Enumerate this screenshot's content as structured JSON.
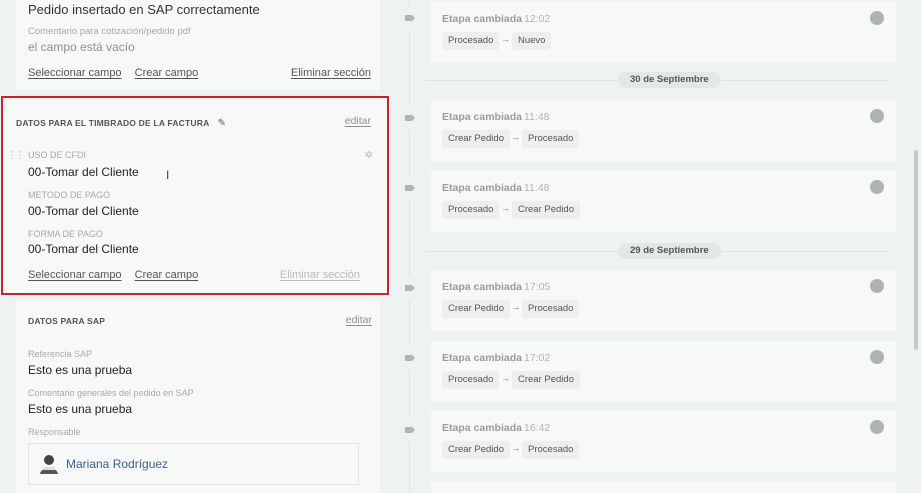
{
  "top_card": {
    "message": "Pedido insertado en SAP correctamente",
    "comment_label": "Comentario para cotización/pedido pdf",
    "comment_value": "el campo está vacío",
    "select_field": "Seleccionar campo",
    "create_field": "Crear campo",
    "delete_section": "Eliminar sección"
  },
  "invoice_section": {
    "title": "DATOS PARA EL TIMBRADO DE LA FACTURA",
    "edit": "editar",
    "fields": [
      {
        "label": "USO DE CFDI",
        "value": "00-Tomar del Cliente"
      },
      {
        "label": "METODO DE PAGO",
        "value": "00-Tomar del Cliente"
      },
      {
        "label": "FORMA DE PAGO",
        "value": "00-Tomar del Cliente"
      }
    ],
    "select_field": "Seleccionar campo",
    "create_field": "Crear campo",
    "delete_section": "Eliminar sección"
  },
  "sap_section": {
    "title": "DATOS PARA SAP",
    "edit": "editar",
    "ref_label": "Referencia SAP",
    "ref_value": "Esto es una prueba",
    "comment_label": "Comentario generales del pedido en SAP",
    "comment_value": "Esto es una prueba",
    "resp_label": "Responsable",
    "resp_name": "Mariana Rodríguez"
  },
  "timeline": {
    "dates": [
      "30 de Septiembre",
      "29 de Septiembre"
    ],
    "events": [
      {
        "title": "Etapa cambiada",
        "time": "12:02",
        "from": "Procesado",
        "to": "Nuevo"
      },
      {
        "title": "Etapa cambiada",
        "time": "11:48",
        "from": "Crear Pedido",
        "to": "Procesado"
      },
      {
        "title": "Etapa cambiada",
        "time": "11:48",
        "from": "Procesado",
        "to": "Crear Pedido"
      },
      {
        "title": "Etapa cambiada",
        "time": "17:05",
        "from": "Crear Pedido",
        "to": "Procesado"
      },
      {
        "title": "Etapa cambiada",
        "time": "17:02",
        "from": "Procesado",
        "to": "Crear Pedido"
      },
      {
        "title": "Etapa cambiada",
        "time": "16:42",
        "from": "Crear Pedido",
        "to": "Procesado"
      }
    ],
    "arrow": "→"
  },
  "icons": {
    "drag": "drag-handle-icon",
    "gear": "gear-icon",
    "pencil": "pencil-icon",
    "user": "user-icon",
    "tag": "tag-icon",
    "text_cursor": "text-cursor-icon"
  },
  "colors": {
    "highlight_border": "#c8262d",
    "link": "#3a5f8f"
  }
}
